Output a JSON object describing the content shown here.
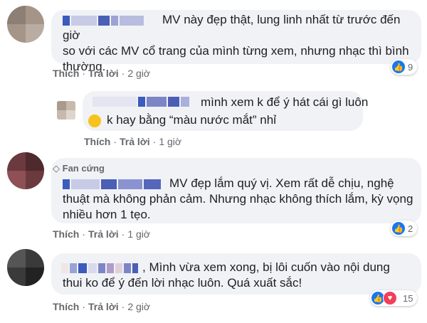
{
  "comments": [
    {
      "text": "MV này đẹp thật, lung linh nhất từ trước đến giờ\nso với các MV cổ trang của mình từng xem, nhưng nhạc thì bình\nthường.",
      "like_label": "Thích",
      "reply_label": "Trả lời",
      "time": "2 giờ",
      "reaction_count": "9"
    },
    {
      "text_line1": "mình xem k để ý hát cái gì luôn",
      "text_line2": "k hay bằng “màu nước mắt” nhỉ",
      "like_label": "Thích",
      "reply_label": "Trả lời",
      "time": "1 giờ"
    },
    {
      "badge": "Fan cứng",
      "text": "MV đẹp lắm quý vị. Xem rất dễ chịu, nghệ\nthuật mà không phản cảm. Nhưng nhạc không thích lắm, kỳ vọng\nnhiều hơn 1 tẹo.",
      "like_label": "Thích",
      "reply_label": "Trả lời",
      "time": "1 giờ",
      "reaction_count": "2"
    },
    {
      "text": ", Mình vừa xem xong, bị lôi cuốn vào nội dung\nthui ko để ý đến lời nhạc luôn. Quá xuất sắc!",
      "like_label": "Thích",
      "reply_label": "Trả lời",
      "time": "2 giờ",
      "reaction_count": "15"
    }
  ],
  "colors": {
    "bubble": "#f0f2f5",
    "like_blue": "#1877f2",
    "love_red": "#f33e58",
    "meta_gray": "#65676b"
  },
  "icons": [
    "like-icon",
    "love-icon",
    "laughing-emoji-icon",
    "diamond-icon"
  ]
}
